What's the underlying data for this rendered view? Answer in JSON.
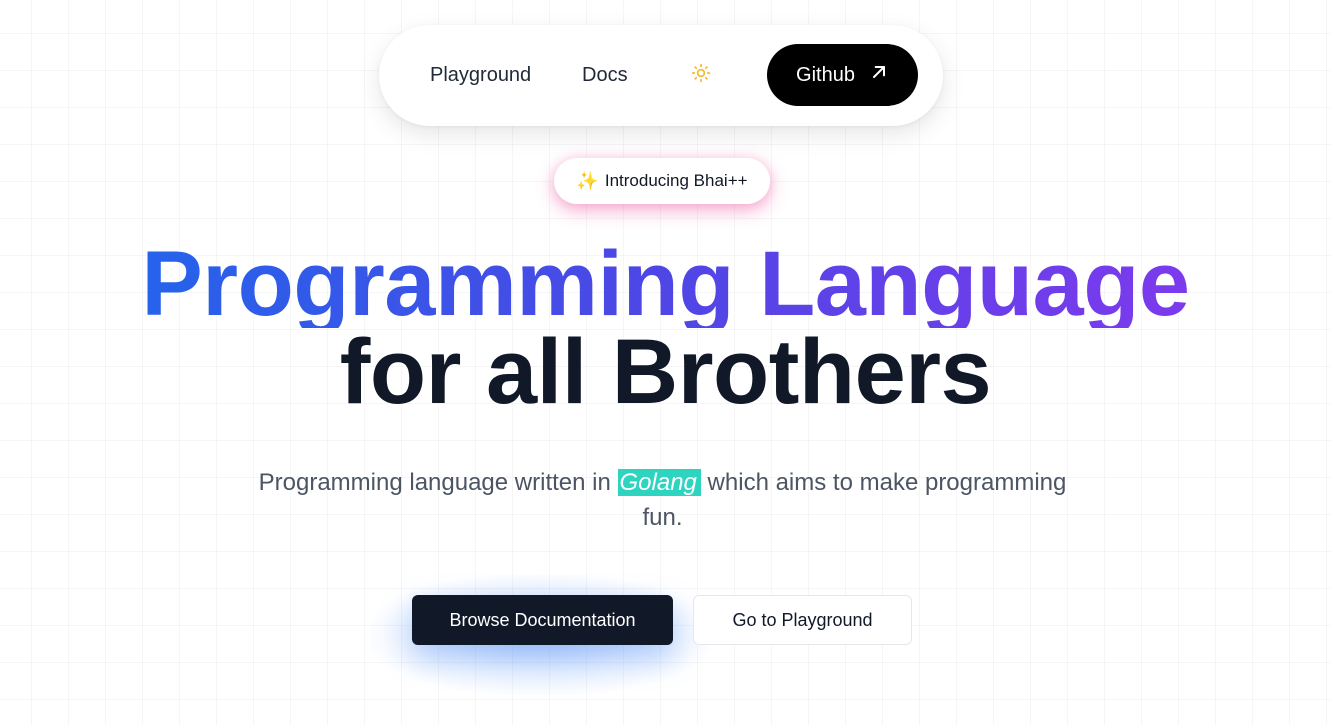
{
  "nav": {
    "playground_label": "Playground",
    "docs_label": "Docs",
    "theme_icon": "sun-icon",
    "github_label": "Github",
    "github_icon": "arrow-up-right-icon"
  },
  "badge": {
    "icon": "sparkles-icon",
    "icon_glyph": "✨",
    "label": "Introducing Bhai++"
  },
  "hero": {
    "title_line1": "Programming Language",
    "title_line2": "for all Brothers",
    "subtitle_before": "Programming language written in ",
    "subtitle_highlight": "Golang",
    "subtitle_after": " which aims to make programming fun."
  },
  "actions": {
    "primary_label": "Browse Documentation",
    "secondary_label": "Go to Playground"
  },
  "colors": {
    "gradient_start": "#2563eb",
    "gradient_end": "#7c3aed",
    "highlight": "#2dd4bf",
    "dark": "#111827",
    "sun": "#f5b82e"
  }
}
